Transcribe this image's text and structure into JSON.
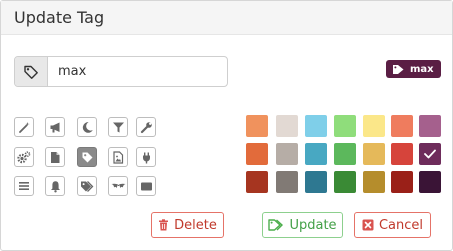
{
  "dialog": {
    "title": "Update Tag"
  },
  "tag_name": {
    "value": "max",
    "placeholder": ""
  },
  "preview": {
    "label": "max",
    "background": "#5a1e44"
  },
  "icons": [
    {
      "name": "magic-wand-icon",
      "selected": false
    },
    {
      "name": "bullhorn-icon",
      "selected": false
    },
    {
      "name": "moon-icon",
      "selected": false
    },
    {
      "name": "filter-icon",
      "selected": false
    },
    {
      "name": "wrench-icon",
      "selected": false
    },
    {
      "name": "cogs-icon",
      "selected": false
    },
    {
      "name": "file-icon",
      "selected": false
    },
    {
      "name": "tag-icon",
      "selected": true
    },
    {
      "name": "file-image-icon",
      "selected": false
    },
    {
      "name": "plug-icon",
      "selected": false
    },
    {
      "name": "list-icon",
      "selected": false
    },
    {
      "name": "bell-icon",
      "selected": false
    },
    {
      "name": "tags-icon",
      "selected": false
    },
    {
      "name": "bat-icon",
      "selected": false
    },
    {
      "name": "card-icon",
      "selected": false
    }
  ],
  "colors": [
    [
      "#f0925d",
      "#e2d9d3",
      "#7fcfe9",
      "#8fdd7b",
      "#fbe789",
      "#ef7c5e",
      "#a5608d"
    ],
    [
      "#e26b3b",
      "#b6ada6",
      "#48a8c2",
      "#5cb85c",
      "#e5b95a",
      "#d6443b",
      "#6e2c5b"
    ],
    [
      "#a63520",
      "#817a75",
      "#2e7891",
      "#3a8a35",
      "#b58d2c",
      "#9a2018",
      "#3a1436"
    ]
  ],
  "selected_color": "#6e2c5b",
  "buttons": {
    "delete": "Delete",
    "update": "Update",
    "cancel": "Cancel"
  }
}
